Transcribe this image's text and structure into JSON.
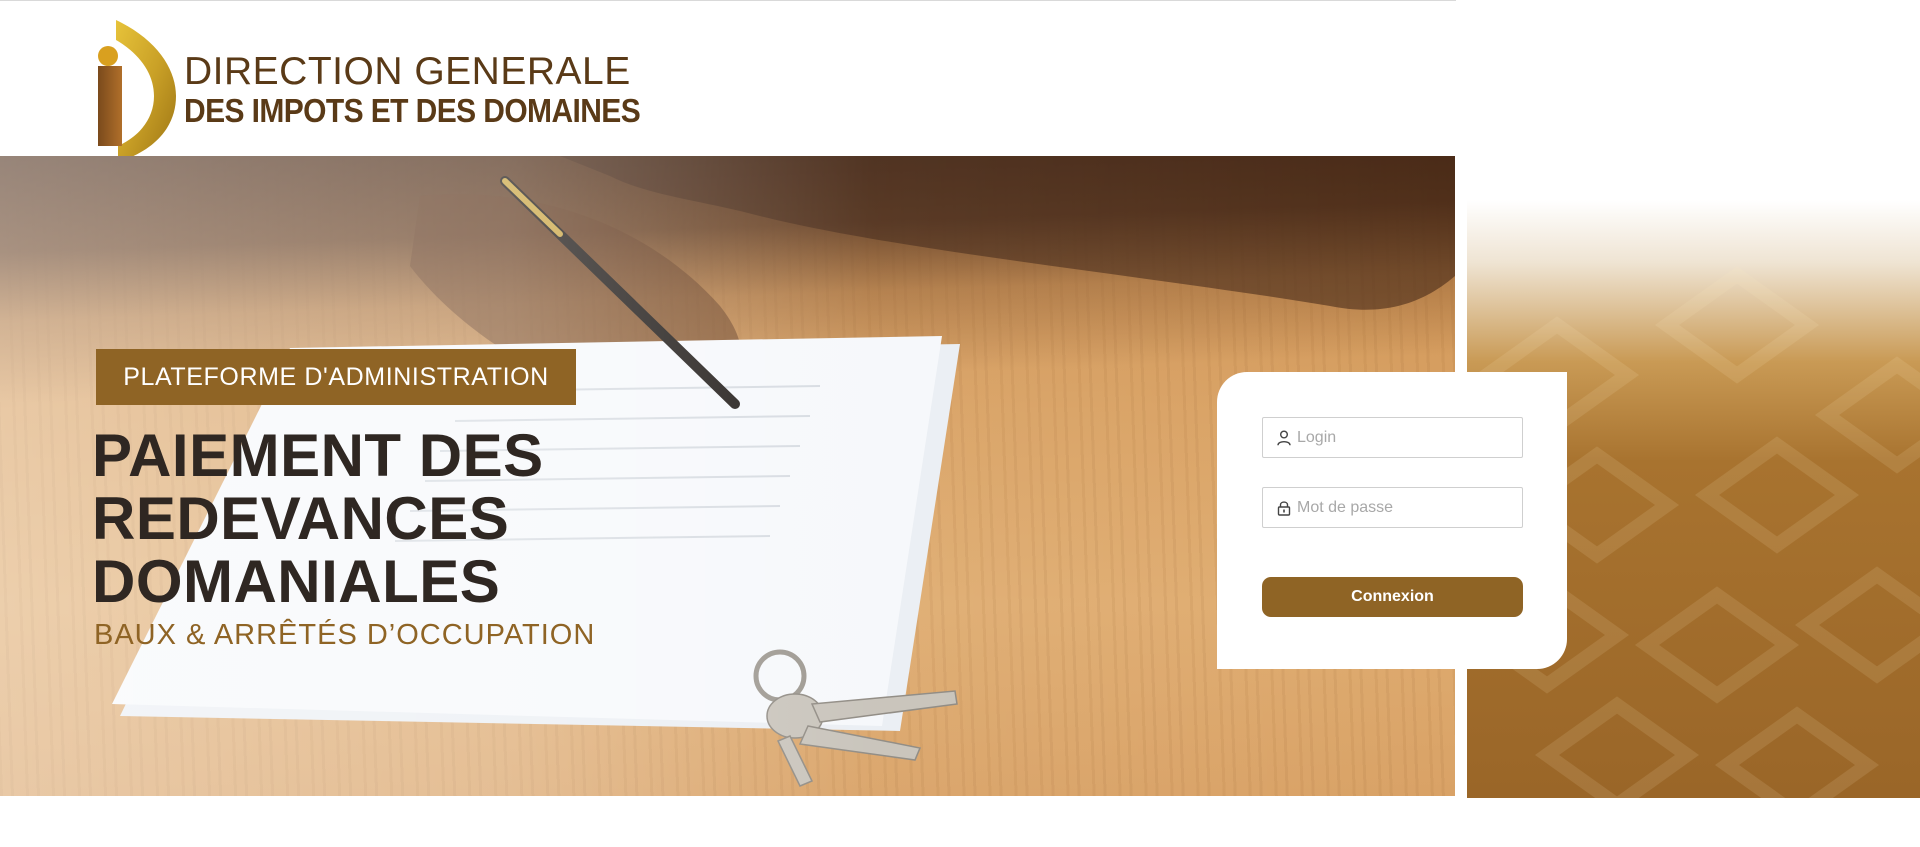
{
  "brand": {
    "line1": "DIRECTION GENERALE",
    "line2": "DES IMPOTS ET DES DOMAINES",
    "logo_icon": "dgid-logo-icon",
    "colors": {
      "gold": "#c9a22a",
      "brown": "#8f6425",
      "dark_brown": "#5a3a17"
    }
  },
  "hero": {
    "badge": "PLATEFORME D'ADMINISTRATION",
    "title_lines": [
      "PAIEMENT DES",
      "REDEVANCES",
      "DOMANIALES"
    ],
    "subtitle": "BAUX & ARRÊTÉS D’OCCUPATION"
  },
  "login": {
    "login_placeholder": "Login",
    "login_value": "",
    "login_icon": "user-icon",
    "password_placeholder": "Mot de passe",
    "password_value": "",
    "password_icon": "lock-icon",
    "submit_label": "Connexion"
  },
  "colors": {
    "accent": "#8f6425",
    "title_text": "#2f2722",
    "card_bg": "#ffffff"
  }
}
